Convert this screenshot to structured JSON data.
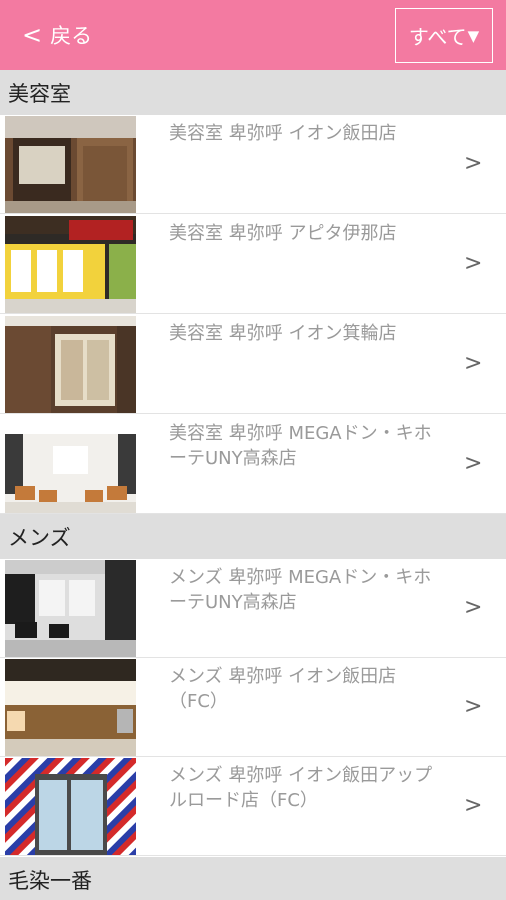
{
  "header": {
    "back_label": "戻る",
    "filter_label": "すべて",
    "accent_color": "#f37aa1"
  },
  "sections": [
    {
      "label": "美容室",
      "items": [
        {
          "title": "美容室 卑弥呼 イオン飯田店"
        },
        {
          "title": "美容室 卑弥呼 アピタ伊那店"
        },
        {
          "title": "美容室 卑弥呼 イオン箕輪店"
        },
        {
          "title": "美容室 卑弥呼 MEGAドン・キホーテUNY高森店"
        }
      ]
    },
    {
      "label": "メンズ",
      "items": [
        {
          "title": "メンズ 卑弥呼 MEGAドン・キホーテUNY高森店"
        },
        {
          "title": "メンズ 卑弥呼 イオン飯田店（FC）"
        },
        {
          "title": "メンズ 卑弥呼 イオン飯田アップルロード店（FC）"
        }
      ]
    },
    {
      "label": "毛染一番",
      "items": []
    }
  ],
  "icons": {
    "back": "chevron-left-icon",
    "filter": "triangle-down-icon",
    "row": "chevron-right-icon"
  }
}
